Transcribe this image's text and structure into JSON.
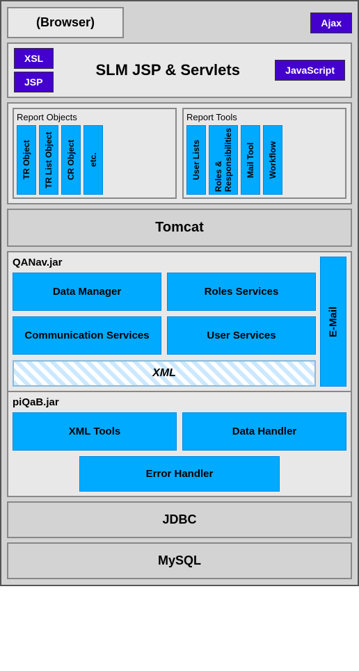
{
  "browser": {
    "label": "(Browser)"
  },
  "ajax": {
    "label": "Ajax"
  },
  "slm": {
    "title": "SLM JSP & Servlets",
    "left_btns": [
      "XSL",
      "JSP"
    ],
    "right_btns": [
      "JavaScript"
    ]
  },
  "report_objects": {
    "section_title": "Report Objects",
    "items": [
      "TR Object",
      "TR List Object",
      "CR Object",
      "etc."
    ]
  },
  "report_tools": {
    "section_title": "Report Tools",
    "items": [
      "User Lists",
      "Roles & Responsibilities",
      "Mail Tool",
      "Workflow"
    ]
  },
  "tomcat": {
    "label": "Tomcat"
  },
  "qanav": {
    "label": "QANav.jar",
    "services": [
      "Data Manager",
      "Roles Services",
      "Communication Services",
      "User Services"
    ],
    "xml_label": "XML",
    "email_label": "E-Mail"
  },
  "piqab": {
    "label": "piQaB.jar",
    "tools": [
      "XML Tools",
      "Data Handler"
    ],
    "error": "Error Handler"
  },
  "jdbc": {
    "label": "JDBC"
  },
  "mysql": {
    "label": "MySQL"
  }
}
